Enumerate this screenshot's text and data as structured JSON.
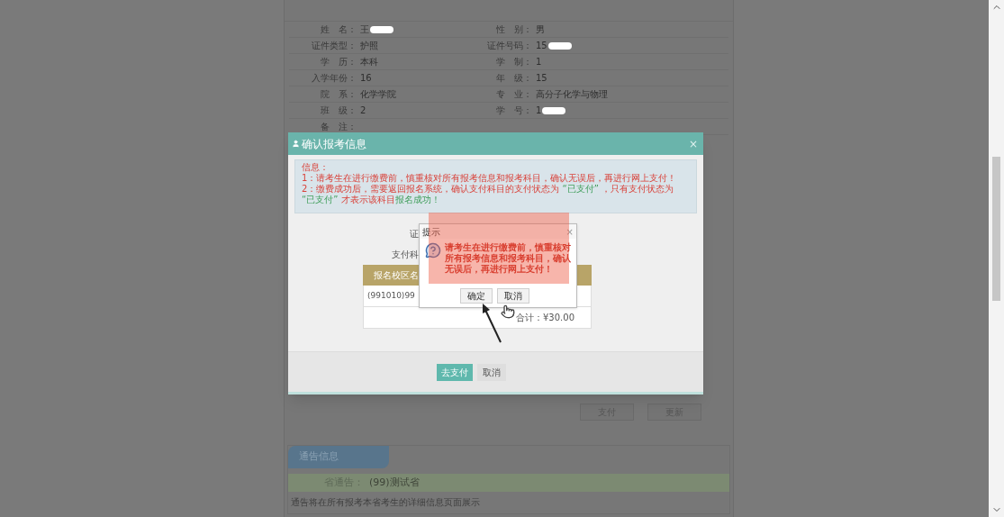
{
  "student_info": [
    {
      "label": "姓　名：",
      "value": "王",
      "redacted": true
    },
    {
      "label": "性　别：",
      "value": "男",
      "redacted": false
    },
    {
      "label": "证件类型：",
      "value": "护照",
      "redacted": false
    },
    {
      "label": "证件号码：",
      "value": "15",
      "redacted": true
    },
    {
      "label": "学　历：",
      "value": "本科",
      "redacted": false
    },
    {
      "label": "学　制：",
      "value": "1",
      "redacted": false
    },
    {
      "label": "入学年份：",
      "value": "16",
      "redacted": false
    },
    {
      "label": "年　级：",
      "value": "15",
      "redacted": false
    },
    {
      "label": "院　系：",
      "value": "化学学院",
      "redacted": false
    },
    {
      "label": "专　业：",
      "value": "高分子化学与物理",
      "redacted": false
    },
    {
      "label": "班　级：",
      "value": "2",
      "redacted": false
    },
    {
      "label": "学　号：",
      "value": "1",
      "redacted": true
    },
    {
      "label": "备　注：",
      "redacted": false
    }
  ],
  "modal": {
    "title": "确认报考信息",
    "close": "×",
    "notice": {
      "heading": "信息：",
      "lines": [
        [
          {
            "text": "1：请考生在进行缴费前，慎重核对所有报考信息和报考科目，确认无误后，再进行网上支付！",
            "kind": "normal"
          }
        ],
        [
          {
            "text": "2：缴费成功后，需要返回报名系统，确认支付科目的支付状态为 ",
            "kind": "normal"
          },
          {
            "text": "“已支付”",
            "kind": "highlight"
          },
          {
            "text": " ，只有支付状态为 ",
            "kind": "normal"
          },
          {
            "text": "“已支付”",
            "kind": "highlight"
          },
          {
            "text": " 才表示该科目",
            "kind": "normal"
          },
          {
            "text": "报名成功！",
            "kind": "highlight"
          }
        ]
      ]
    },
    "fragments": [
      "证",
      "支付科"
    ],
    "table": {
      "header": "报名校区名",
      "row": "(991010)99",
      "total": "合计：¥30.00"
    },
    "buttons": [
      {
        "label": "去支付",
        "primary": true
      },
      {
        "label": "取消",
        "primary": false
      }
    ]
  },
  "prompt": {
    "title": "提示",
    "close": "×",
    "message": "请考生在进行缴费前，慎重核对所有报考信息和报考科目，确认无误后，再进行网上支付！",
    "buttons": [
      "确定",
      "取消"
    ]
  },
  "page_buttons": [
    "支付",
    "更新"
  ],
  "notice_section": {
    "tab": "通告信息",
    "province_label": "省通告：",
    "province": "(99)测试省",
    "description": "通告将在所有报考本省考生的详细信息页面展示"
  }
}
